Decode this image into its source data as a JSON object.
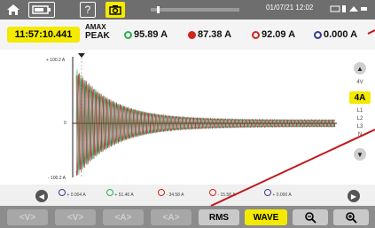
{
  "topbar": {
    "icons": [
      "home-icon",
      "battery-icon",
      "help-icon",
      "camera-icon"
    ],
    "datetime": "01/07/21 12:02"
  },
  "measurements": {
    "time": "11:57:10.441",
    "amax_label_line1": "AMAX",
    "amax_label_line2": "PEAK",
    "a1": "95.89 A",
    "a2": "87.38 A",
    "a3": "92.09 A",
    "an": "0.000 A",
    "colors": {
      "a1": "#2bb04a",
      "a2": "#d0261c",
      "a3": "#d0261c",
      "an": "#3b3b8f"
    }
  },
  "chart": {
    "ymax_label": "+ 100.2 A",
    "ymid_label": "0",
    "ymin_label": "- 100.2 A"
  },
  "right_panel": {
    "labels": [
      "4V",
      "4A",
      "L1",
      "L2",
      "L3",
      "N"
    ]
  },
  "cursor_values": {
    "v1": "+ 0.004 A",
    "v2": "+ 51.46 A",
    "v3": "- 34.58 A",
    "v4": "- 15.58 A",
    "v5": "+ 0.000 A"
  },
  "bottombar": {
    "btn1": "<V>",
    "btn2": "<V>",
    "btn3": "<A>",
    "btn4": "<A>",
    "rms": "RMS",
    "wave": "WAVE",
    "zoom_out": "⌕",
    "zoom_in": "⌕"
  }
}
